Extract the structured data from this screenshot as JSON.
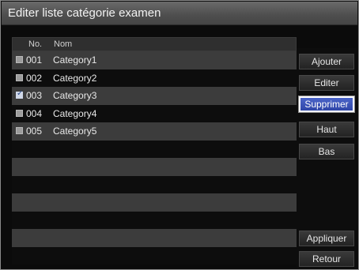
{
  "window": {
    "title": "Editer liste catégorie examen"
  },
  "list": {
    "columns": {
      "no": "No.",
      "nom": "Nom"
    },
    "rows": [
      {
        "no": "001",
        "nom": "Category1",
        "checked": false
      },
      {
        "no": "002",
        "nom": "Category2",
        "checked": false
      },
      {
        "no": "003",
        "nom": "Category3",
        "checked": true
      },
      {
        "no": "004",
        "nom": "Category4",
        "checked": false
      },
      {
        "no": "005",
        "nom": "Category5",
        "checked": false
      }
    ]
  },
  "buttons": {
    "ajouter": "Ajouter",
    "editer": "Editer",
    "supprimer": "Supprimer",
    "haut": "Haut",
    "bas": "Bas",
    "appliquer": "Appliquer",
    "retour": "Retour"
  },
  "colors": {
    "accent": "#3f58bf",
    "row_alt": "#3c3c3c"
  }
}
